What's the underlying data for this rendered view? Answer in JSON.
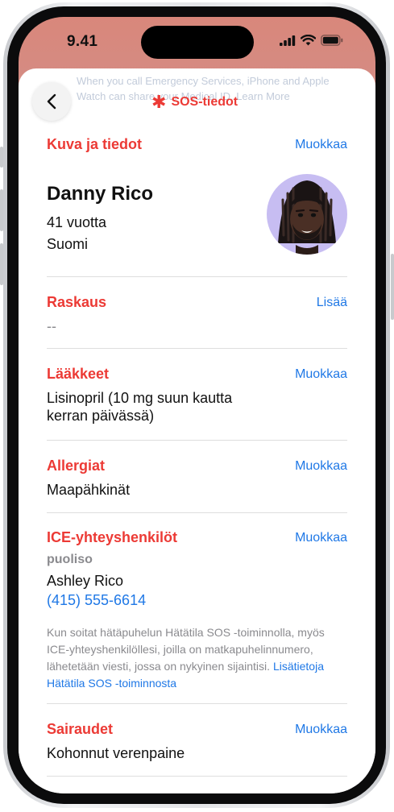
{
  "status_bar": {
    "time": "9.41"
  },
  "background_hint": {
    "line1": "When you call Emergency Services, iPhone and Apple",
    "line2": "Watch can share your Medical ID. Learn More"
  },
  "nav": {
    "title": "SOS-tiedot"
  },
  "profile": {
    "section_title": "Kuva ja tiedot",
    "edit_label": "Muokkaa",
    "name": "Danny Rico",
    "age": "41 vuotta",
    "country": "Suomi"
  },
  "pregnancy": {
    "title": "Raskaus",
    "action_label": "Lisää",
    "value": "--"
  },
  "medications": {
    "title": "Lääkkeet",
    "edit_label": "Muokkaa",
    "line1": "Lisinopril (10 mg suun kautta",
    "line2": "kerran päivässä)"
  },
  "allergies": {
    "title": "Allergiat",
    "edit_label": "Muokkaa",
    "value": "Maapähkinät"
  },
  "ice_contacts": {
    "title": "ICE-yhteyshenkilöt",
    "edit_label": "Muokkaa",
    "relation": "puoliso",
    "name": "Ashley Rico",
    "phone": "(415) 555-6614",
    "note_line1": "Kun soitat hätäpuhelun Hätätila SOS -toiminnolla, myös",
    "note_line2": "ICE-yhteyshenkilöllesi, joilla on matkapuhelinnumero,",
    "note_line3": "lähetetään viesti, jossa on nykyinen sijaintisi.",
    "note_link_part1": "Lisätietoja",
    "note_link_part2": "Hätätila SOS -toiminnosta"
  },
  "conditions": {
    "title": "Sairaudet",
    "edit_label": "Muokkaa",
    "value": "Kohonnut verenpaine"
  },
  "colors": {
    "accent_red": "#ec3a35",
    "link_blue": "#1f78e6",
    "secondary_gray": "#8a8a8e"
  },
  "icons": [
    "chevron-left-icon",
    "asterisk-icon",
    "cellular-signal-icon",
    "wifi-icon",
    "battery-icon",
    "memoji-avatar"
  ]
}
